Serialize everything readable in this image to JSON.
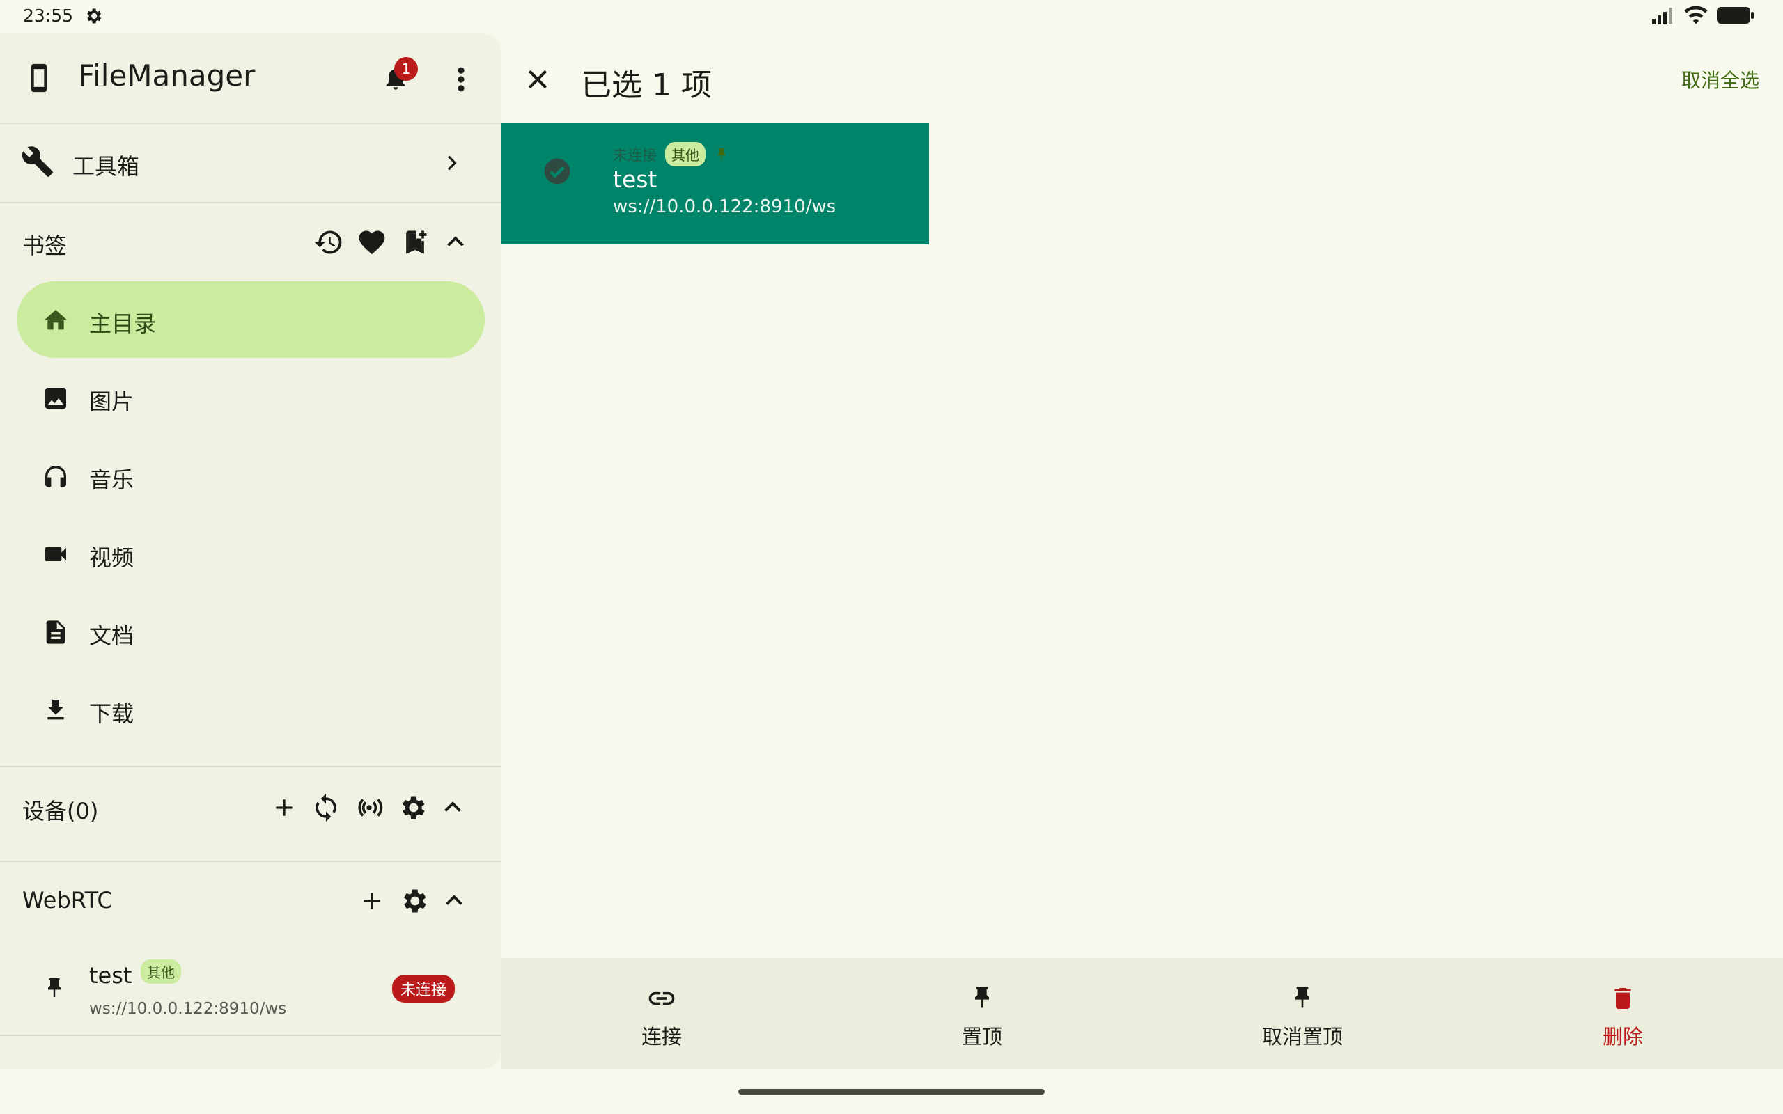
{
  "status_bar": {
    "time": "23:55",
    "icons": [
      "settings-icon",
      "signal-icon",
      "wifi-icon",
      "battery-icon"
    ]
  },
  "sidebar": {
    "app_title": "FileManager",
    "notification_count": "1",
    "toolbox_label": "工具箱",
    "bookmarks": {
      "title": "书签",
      "actions": [
        "history-icon",
        "favorite-icon",
        "bookmark-add-icon",
        "collapse-icon"
      ],
      "items": [
        {
          "label": "主目录",
          "icon": "home-icon",
          "active": true
        },
        {
          "label": "图片",
          "icon": "image-icon",
          "active": false
        },
        {
          "label": "音乐",
          "icon": "headphones-icon",
          "active": false
        },
        {
          "label": "视频",
          "icon": "video-icon",
          "active": false
        },
        {
          "label": "文档",
          "icon": "document-icon",
          "active": false
        },
        {
          "label": "下载",
          "icon": "download-icon",
          "active": false
        }
      ]
    },
    "devices": {
      "title": "设备(0)",
      "actions": [
        "add-icon",
        "sync-icon",
        "broadcast-icon",
        "settings-icon",
        "collapse-icon"
      ]
    },
    "webrtc": {
      "title": "WebRTC",
      "actions": [
        "add-icon",
        "settings-icon",
        "collapse-icon"
      ],
      "item": {
        "name": "test",
        "tag": "其他",
        "url": "ws://10.0.0.122:8910/ws",
        "status": "未连接"
      }
    }
  },
  "topbar": {
    "title": "已选 1 项",
    "deselect_all": "取消全选"
  },
  "selected_card": {
    "status": "未连接",
    "tag": "其他",
    "name": "test",
    "url": "ws://10.0.0.122:8910/ws"
  },
  "bottom_actions": [
    {
      "label": "连接",
      "icon": "link-icon"
    },
    {
      "label": "置顶",
      "icon": "pin-icon"
    },
    {
      "label": "取消置顶",
      "icon": "unpin-icon"
    },
    {
      "label": "删除",
      "icon": "delete-icon"
    }
  ],
  "colors": {
    "background": "#f7f9ec",
    "sidebar": "#f0f2e4",
    "active_nav": "#cbec9e",
    "card": "#00856a",
    "danger": "#ba1a1a",
    "accent_text": "#3f6a12"
  }
}
